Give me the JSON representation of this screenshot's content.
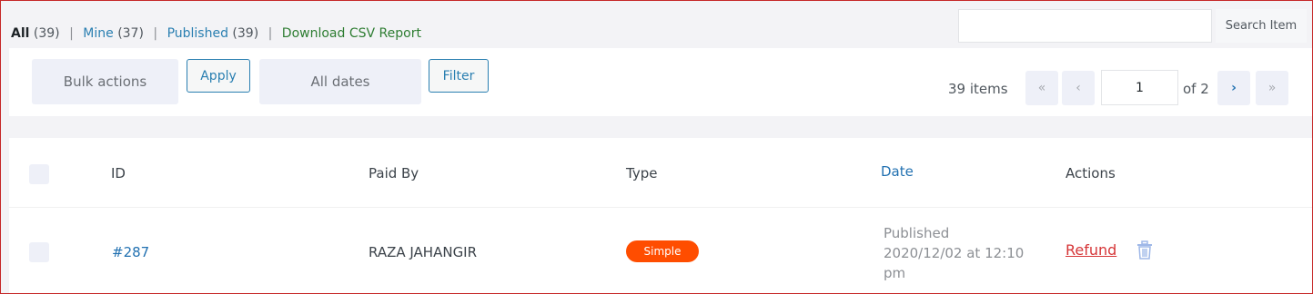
{
  "views": {
    "all_label": "All",
    "all_count": "(39)",
    "mine_label": "Mine",
    "mine_count": "(37)",
    "published_label": "Published",
    "published_count": "(39)",
    "download_label": "Download CSV Report"
  },
  "search": {
    "input_value": "",
    "button_label": "Search Item"
  },
  "toolbar": {
    "bulk_actions": "Bulk actions",
    "apply_label": "Apply",
    "dates": "All dates",
    "filter_label": "Filter"
  },
  "pagination": {
    "items_count": "39 items",
    "first": "«",
    "prev": "‹",
    "current_page": "1",
    "of_total": "of 2",
    "next": "›",
    "last": "»"
  },
  "table": {
    "columns": [
      "ID",
      "Paid By",
      "Type",
      "Date",
      "Actions"
    ],
    "rows": [
      {
        "id": "#287",
        "paid_by": "RAZA JAHANGIR",
        "type": "Simple",
        "date_status": "Published",
        "date_line1": "2020/12/02 at 12:10",
        "date_line2": "pm",
        "action": "Refund"
      }
    ]
  },
  "colors": {
    "accent": "#2271b1",
    "badge": "#ff4d00",
    "refund": "#d63638",
    "download_link": "#2e7d32"
  },
  "icons": {
    "delete": "trash-icon"
  }
}
